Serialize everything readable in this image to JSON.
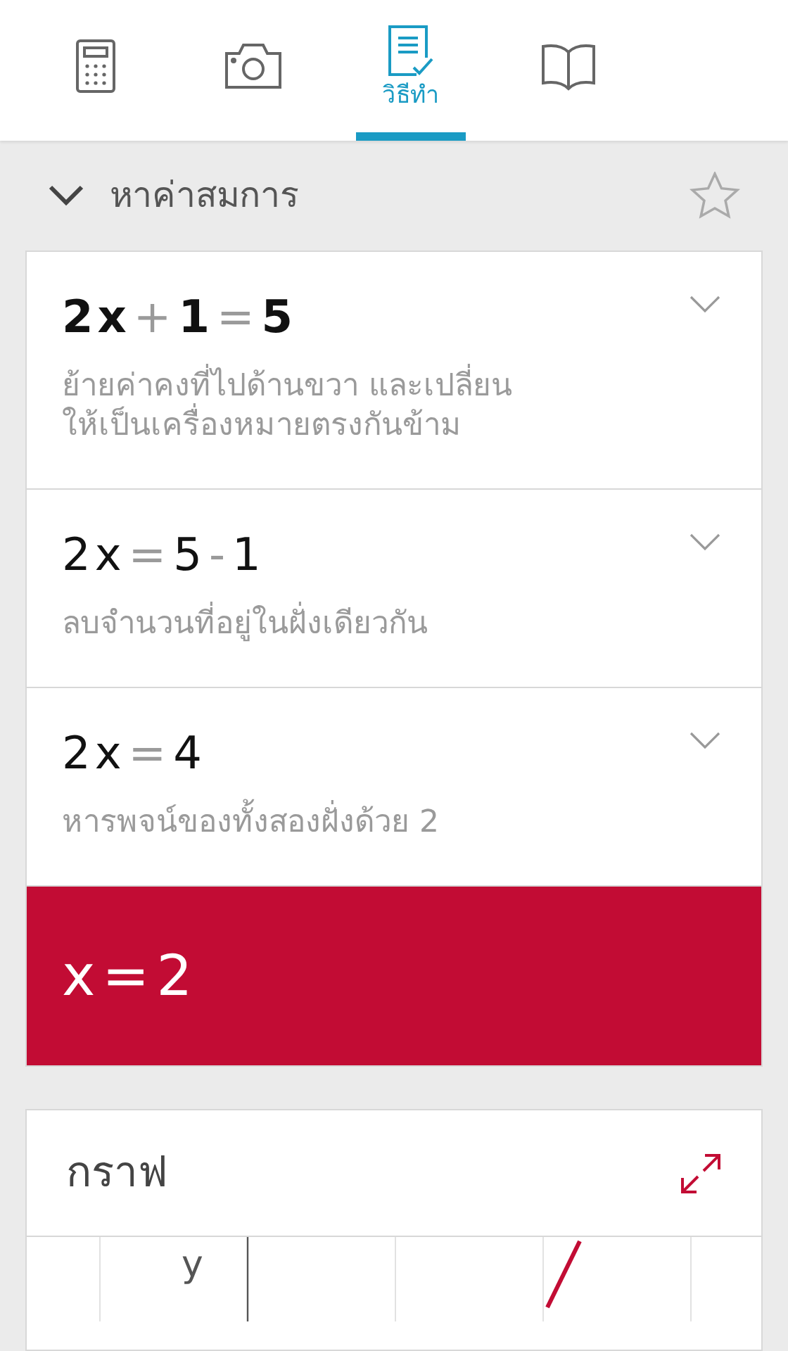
{
  "tabs": [
    {
      "kind": "calculator",
      "selected": false
    },
    {
      "kind": "camera",
      "selected": false
    },
    {
      "kind": "steps",
      "label": "วิธีทำ",
      "selected": true
    },
    {
      "kind": "book",
      "selected": false
    }
  ],
  "section": {
    "title": "หาค่าสมการ",
    "expanded": true,
    "favorite": false
  },
  "steps": [
    {
      "equation": [
        {
          "text": "2",
          "kind": "term"
        },
        {
          "text": "x",
          "kind": "term"
        },
        {
          "text": "+",
          "kind": "op"
        },
        {
          "text": "1",
          "kind": "term"
        },
        {
          "text": "=",
          "kind": "op"
        },
        {
          "text": "5",
          "kind": "term"
        }
      ],
      "emphasized": true,
      "explanation": "ย้ายค่าคงที่ไปด้านขวา และเปลี่ยน\nให้เป็นเครื่องหมายตรงกันข้าม"
    },
    {
      "equation": [
        {
          "text": "2",
          "kind": "term"
        },
        {
          "text": "x",
          "kind": "term"
        },
        {
          "text": "=",
          "kind": "op"
        },
        {
          "text": "5",
          "kind": "term"
        },
        {
          "text": "-",
          "kind": "op"
        },
        {
          "text": "1",
          "kind": "term"
        }
      ],
      "emphasized": false,
      "explanation": "ลบจำนวนที่อยู่ในฝั่งเดียวกัน"
    },
    {
      "equation": [
        {
          "text": "2",
          "kind": "term"
        },
        {
          "text": "x",
          "kind": "term"
        },
        {
          "text": "=",
          "kind": "op"
        },
        {
          "text": "4",
          "kind": "term"
        }
      ],
      "emphasized": false,
      "explanation": "หารพจน์ของทั้งสองฝั่งด้วย 2"
    }
  ],
  "result": [
    {
      "text": "x",
      "kind": "term"
    },
    {
      "text": "=",
      "kind": "op"
    },
    {
      "text": "2",
      "kind": "term"
    }
  ],
  "graph": {
    "title": "กราฟ",
    "axis_label": "y"
  }
}
